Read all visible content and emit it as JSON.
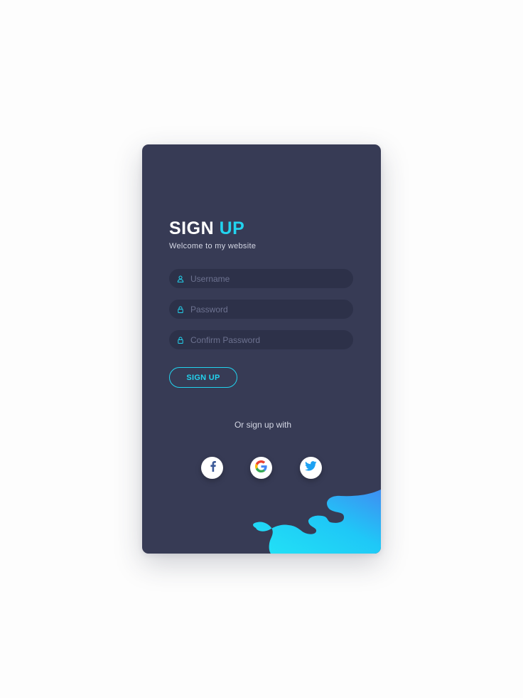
{
  "heading": {
    "word1": "SIGN",
    "word2": "UP"
  },
  "subtitle": "Welcome to my website",
  "fields": [
    {
      "placeholder": "Username",
      "icon": "user-icon"
    },
    {
      "placeholder": "Password",
      "icon": "lock-icon"
    },
    {
      "placeholder": "Confirm Password",
      "icon": "lock-icon"
    }
  ],
  "submit_label": "SIGN UP",
  "social": {
    "caption": "Or sign up with",
    "providers": [
      "facebook-icon",
      "google-icon",
      "twitter-icon"
    ]
  },
  "colors": {
    "card": "#373b55",
    "field": "#2d3149",
    "accent": "#22d3ee",
    "text": "#ffffff"
  }
}
